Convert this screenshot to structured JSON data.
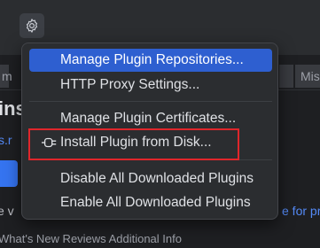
{
  "background": {
    "heading_fragment": "ins",
    "link_fragment": "s.r",
    "text_fragment": "e v",
    "link2_fragment": "e for pr",
    "right_tab_fragment": "Mis",
    "left_tab_fragment": "m",
    "bottom_fragment": "What's New  Reviews  Additional Info"
  },
  "menu": {
    "items": [
      {
        "label": "Manage Plugin Repositories...",
        "selected": true
      },
      {
        "label": "HTTP Proxy Settings..."
      },
      {
        "label": "Manage Plugin Certificates..."
      },
      {
        "label": "Install Plugin from Disk...",
        "icon": "plug-icon",
        "highlighted": true
      },
      {
        "label": "Disable All Downloaded Plugins"
      },
      {
        "label": "Enable All Downloaded Plugins"
      }
    ]
  },
  "colors": {
    "selection": "#2e5fd0",
    "highlight_border": "#e0262b",
    "menu_bg": "#2b2d30",
    "link": "#548af7"
  },
  "icons": {
    "settings_button": "gear-icon"
  }
}
